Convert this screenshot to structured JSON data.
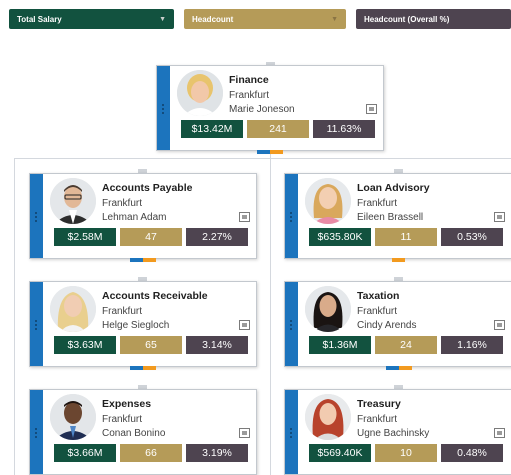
{
  "filters": [
    {
      "label": "Total Salary",
      "color": "#12523f",
      "has_chevron": true
    },
    {
      "label": "Headcount",
      "color": "#b59b58",
      "has_chevron": true
    },
    {
      "label": "Headcount (Overall %)",
      "color": "#4e4450",
      "has_chevron": false
    }
  ],
  "colors": {
    "accent": "#1c74bd",
    "salary": "#12523f",
    "headcount": "#b59b58",
    "percent": "#4e4450",
    "line_orange": "#f29a1f"
  },
  "root": {
    "title": "Finance",
    "location": "Frankfurt",
    "person": "Marie Joneson",
    "salary": "$13.42M",
    "headcount": "241",
    "percent": "11.63%"
  },
  "left": [
    {
      "title": "Accounts Payable",
      "location": "Frankfurt",
      "person": "Lehman Adam",
      "salary": "$2.58M",
      "headcount": "47",
      "percent": "2.27%"
    },
    {
      "title": "Accounts Receivable",
      "location": "Frankfurt",
      "person": "Helge Siegloch",
      "salary": "$3.63M",
      "headcount": "65",
      "percent": "3.14%"
    },
    {
      "title": "Expenses",
      "location": "Frankfurt",
      "person": "Conan Bonino",
      "salary": "$3.66M",
      "headcount": "66",
      "percent": "3.19%"
    }
  ],
  "right": [
    {
      "title": "Loan Advisory",
      "location": "Frankfurt",
      "person": "Eileen Brassell",
      "salary": "$635.80K",
      "headcount": "11",
      "percent": "0.53%"
    },
    {
      "title": "Taxation",
      "location": "Frankfurt",
      "person": "Cindy Arends",
      "salary": "$1.36M",
      "headcount": "24",
      "percent": "1.16%"
    },
    {
      "title": "Treasury",
      "location": "Frankfurt",
      "person": "Ugne Bachinsky",
      "salary": "$569.40K",
      "headcount": "10",
      "percent": "0.48%"
    }
  ],
  "icons": {
    "expand": "zoom-icon",
    "drag": "drag-handle-icon"
  }
}
